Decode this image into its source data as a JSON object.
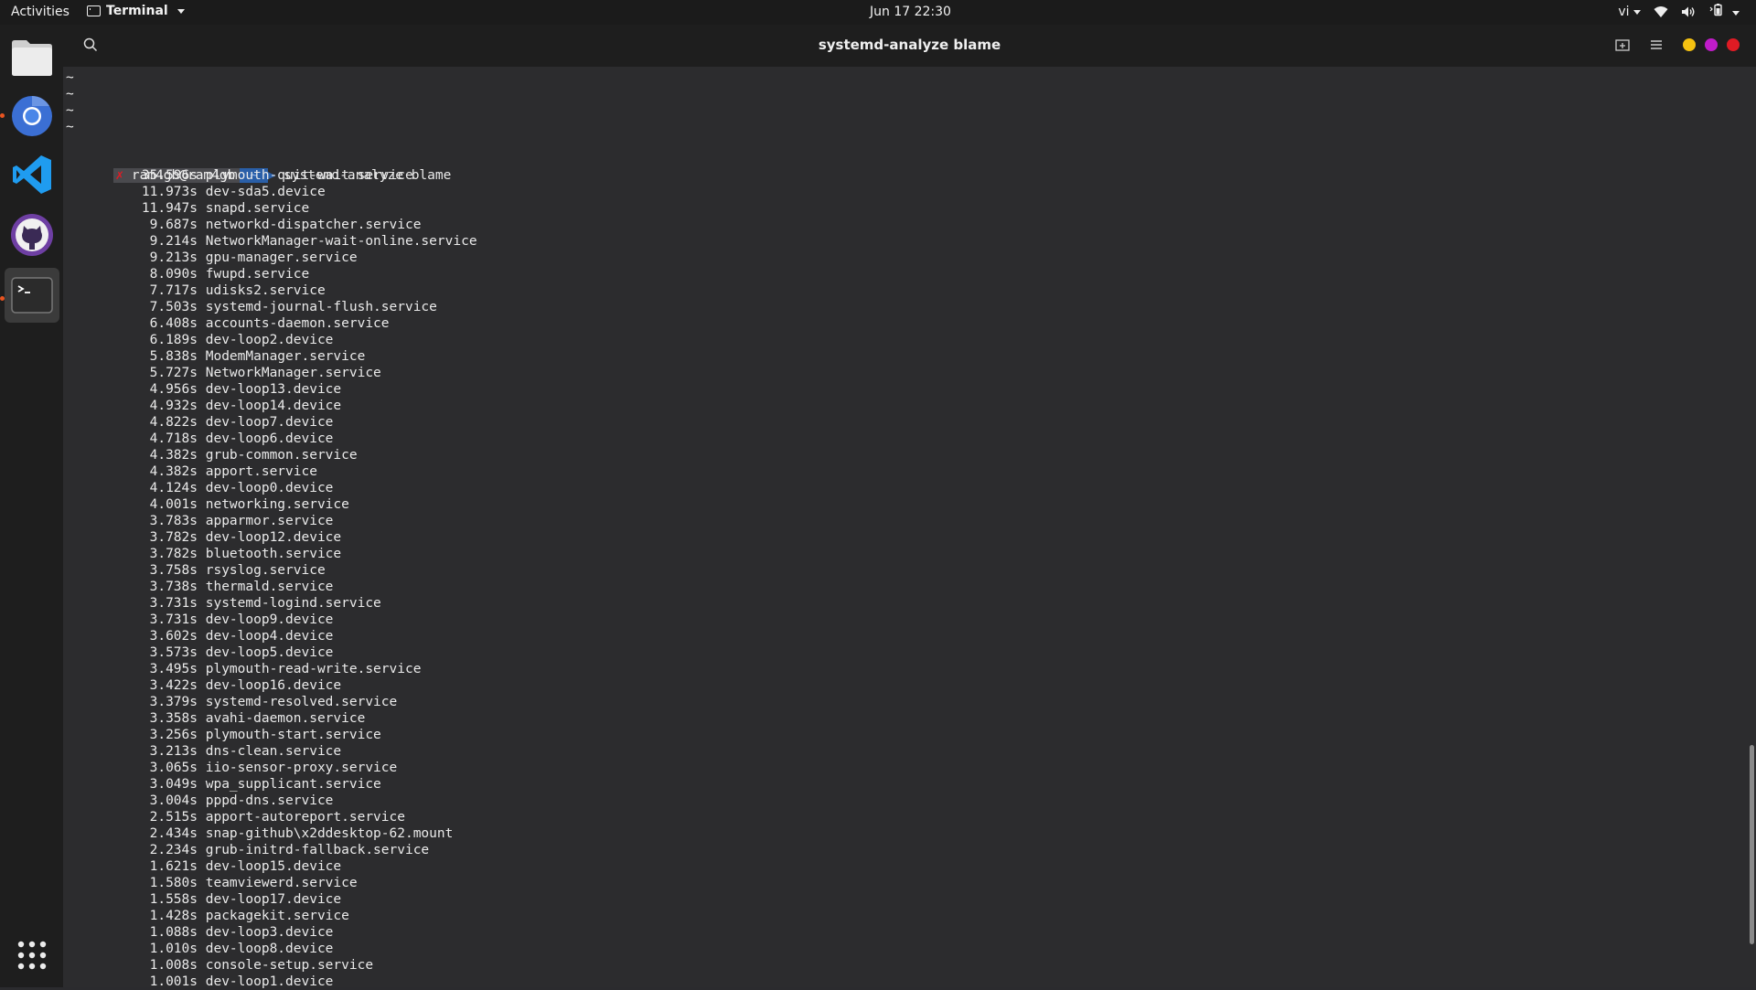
{
  "topbar": {
    "activities": "Activities",
    "app_name": "Terminal",
    "clock": "Jun 17  22:30",
    "input_method": "vi"
  },
  "dock": {
    "items": [
      {
        "name": "files",
        "icon": "folder-icon"
      },
      {
        "name": "chromium",
        "icon": "chromium-icon"
      },
      {
        "name": "vscode",
        "icon": "vscode-icon"
      },
      {
        "name": "github-desktop",
        "icon": "github-icon"
      },
      {
        "name": "terminal",
        "icon": "terminal-icon"
      }
    ],
    "apps_grid_icon": "grid-icon"
  },
  "window": {
    "title": "systemd-analyze blame"
  },
  "terminal": {
    "tildes": [
      "~",
      "~",
      "~",
      "~"
    ],
    "prompt": {
      "marker": "✗",
      "user": "ram4gb@ram4gb",
      "dir": " ~ ",
      "command": "systemd-analyze blame"
    },
    "rows": [
      {
        "time": "35.596s",
        "unit": "plymouth-quit-wait.service"
      },
      {
        "time": "11.973s",
        "unit": "dev-sda5.device"
      },
      {
        "time": "11.947s",
        "unit": "snapd.service"
      },
      {
        "time": "9.687s",
        "unit": "networkd-dispatcher.service"
      },
      {
        "time": "9.214s",
        "unit": "NetworkManager-wait-online.service"
      },
      {
        "time": "9.213s",
        "unit": "gpu-manager.service"
      },
      {
        "time": "8.090s",
        "unit": "fwupd.service"
      },
      {
        "time": "7.717s",
        "unit": "udisks2.service"
      },
      {
        "time": "7.503s",
        "unit": "systemd-journal-flush.service"
      },
      {
        "time": "6.408s",
        "unit": "accounts-daemon.service"
      },
      {
        "time": "6.189s",
        "unit": "dev-loop2.device"
      },
      {
        "time": "5.838s",
        "unit": "ModemManager.service"
      },
      {
        "time": "5.727s",
        "unit": "NetworkManager.service"
      },
      {
        "time": "4.956s",
        "unit": "dev-loop13.device"
      },
      {
        "time": "4.932s",
        "unit": "dev-loop14.device"
      },
      {
        "time": "4.822s",
        "unit": "dev-loop7.device"
      },
      {
        "time": "4.718s",
        "unit": "dev-loop6.device"
      },
      {
        "time": "4.382s",
        "unit": "grub-common.service"
      },
      {
        "time": "4.382s",
        "unit": "apport.service"
      },
      {
        "time": "4.124s",
        "unit": "dev-loop0.device"
      },
      {
        "time": "4.001s",
        "unit": "networking.service"
      },
      {
        "time": "3.783s",
        "unit": "apparmor.service"
      },
      {
        "time": "3.782s",
        "unit": "dev-loop12.device"
      },
      {
        "time": "3.782s",
        "unit": "bluetooth.service"
      },
      {
        "time": "3.758s",
        "unit": "rsyslog.service"
      },
      {
        "time": "3.738s",
        "unit": "thermald.service"
      },
      {
        "time": "3.731s",
        "unit": "systemd-logind.service"
      },
      {
        "time": "3.731s",
        "unit": "dev-loop9.device"
      },
      {
        "time": "3.602s",
        "unit": "dev-loop4.device"
      },
      {
        "time": "3.573s",
        "unit": "dev-loop5.device"
      },
      {
        "time": "3.495s",
        "unit": "plymouth-read-write.service"
      },
      {
        "time": "3.422s",
        "unit": "dev-loop16.device"
      },
      {
        "time": "3.379s",
        "unit": "systemd-resolved.service"
      },
      {
        "time": "3.358s",
        "unit": "avahi-daemon.service"
      },
      {
        "time": "3.256s",
        "unit": "plymouth-start.service"
      },
      {
        "time": "3.213s",
        "unit": "dns-clean.service"
      },
      {
        "time": "3.065s",
        "unit": "iio-sensor-proxy.service"
      },
      {
        "time": "3.049s",
        "unit": "wpa_supplicant.service"
      },
      {
        "time": "3.004s",
        "unit": "pppd-dns.service"
      },
      {
        "time": "2.515s",
        "unit": "apport-autoreport.service"
      },
      {
        "time": "2.434s",
        "unit": "snap-github\\x2ddesktop-62.mount"
      },
      {
        "time": "2.234s",
        "unit": "grub-initrd-fallback.service"
      },
      {
        "time": "1.621s",
        "unit": "dev-loop15.device"
      },
      {
        "time": "1.580s",
        "unit": "teamviewerd.service"
      },
      {
        "time": "1.558s",
        "unit": "dev-loop17.device"
      },
      {
        "time": "1.428s",
        "unit": "packagekit.service"
      },
      {
        "time": "1.088s",
        "unit": "dev-loop3.device"
      },
      {
        "time": "1.010s",
        "unit": "dev-loop8.device"
      },
      {
        "time": "1.008s",
        "unit": "console-setup.service"
      },
      {
        "time": "1.001s",
        "unit": "dev-loop1.device"
      }
    ]
  },
  "colors": {
    "accent_running": "#e95420",
    "win_min": "#f5c211",
    "win_max": "#c01cc9",
    "win_close": "#e01b24"
  }
}
